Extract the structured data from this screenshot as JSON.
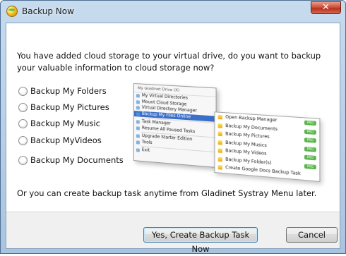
{
  "window": {
    "title": "Backup Now",
    "close_glyph": "✕"
  },
  "prompt": "You have added cloud storage to your virtual drive, do you want to backup your valuable information to cloud storage now?",
  "options": [
    {
      "label": "Backup My Folders"
    },
    {
      "label": "Backup My Pictures"
    },
    {
      "label": "Backup My Music"
    },
    {
      "label": "Backup MyVideos"
    },
    {
      "label": "Backup My Documents"
    }
  ],
  "illustration": {
    "menu_header": "My Gladinet Drive (X)",
    "menu_items": [
      "My Virtual Directories",
      "Mount Cloud Storage",
      "Virtual Directory Manager",
      "Backup My Files Online",
      "Task Manager",
      "Resume All Paused Tasks",
      "Upgrade Starter Edition",
      "Tools",
      "Exit"
    ],
    "submenu_items": [
      "Open Backup Manager",
      "Backup My Documents",
      "Backup My Pictures",
      "Backup My Musics",
      "Backup My Videos",
      "Backup My Folder(s)",
      "Create Google Docs Backup Task"
    ],
    "badge": "PRO"
  },
  "later_text": "Or you can create backup task anytime from Gladinet Systray Menu later.",
  "buttons": {
    "create": "Yes, Create Backup Task Now",
    "cancel": "Cancel"
  }
}
